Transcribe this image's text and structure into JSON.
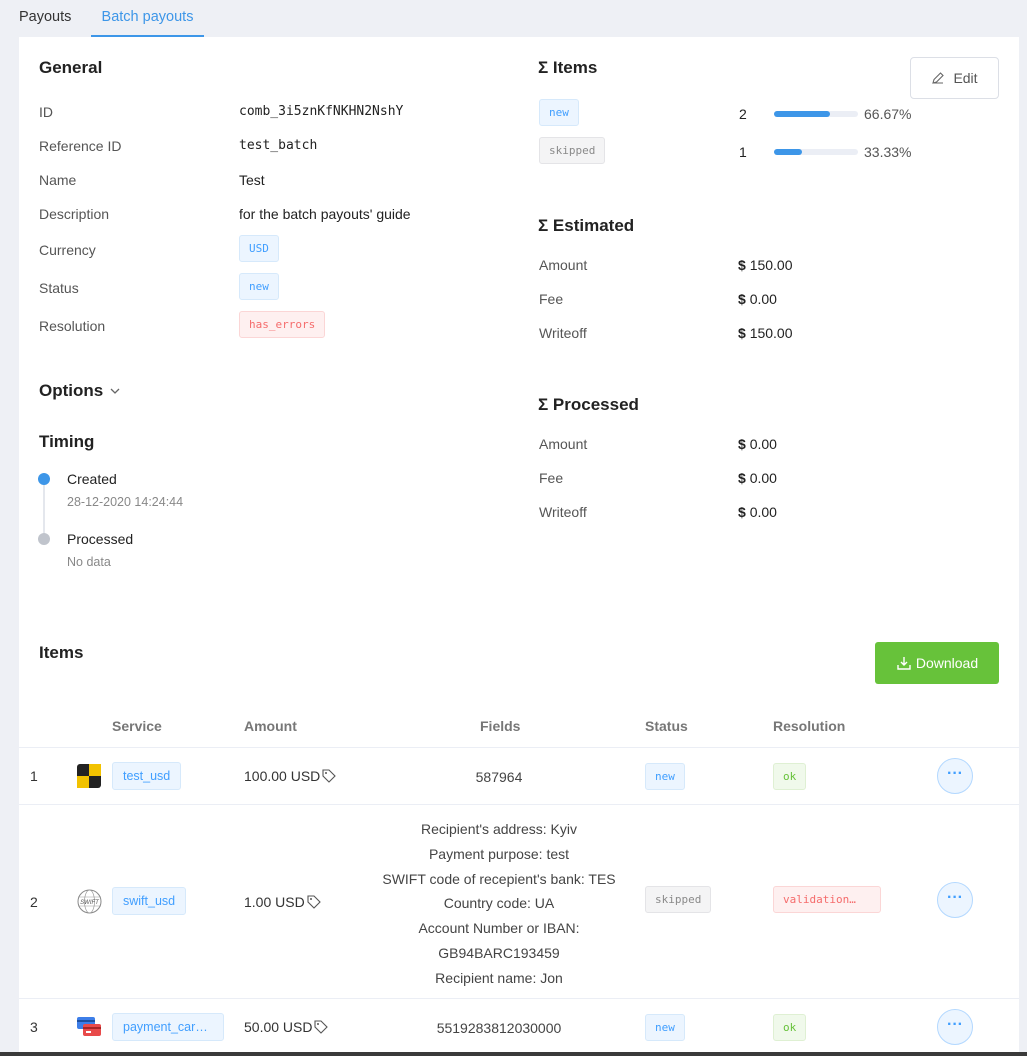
{
  "tabs": [
    {
      "label": "Payouts",
      "active": false
    },
    {
      "label": "Batch payouts",
      "active": true
    }
  ],
  "general": {
    "title": "General",
    "rows": [
      {
        "label": "ID",
        "value": "comb_3i5znKfNKHN2NshY"
      },
      {
        "label": "Reference ID",
        "value": "test_batch"
      },
      {
        "label": "Name",
        "value": "Test"
      },
      {
        "label": "Description",
        "value": "for the batch payouts' guide"
      },
      {
        "label": "Currency",
        "value": "USD"
      },
      {
        "label": "Status",
        "value": "new"
      },
      {
        "label": "Resolution",
        "value": "has_errors"
      }
    ]
  },
  "options": {
    "label": "Options"
  },
  "timing": {
    "title": "Timing",
    "events": [
      {
        "label": "Created",
        "value": "28-12-2020 14:24:44"
      },
      {
        "label": "Processed",
        "value": "No data"
      }
    ]
  },
  "items_summary": {
    "title": "Σ Items",
    "edit_label": "Edit",
    "rows": [
      {
        "status": "new",
        "count": "2",
        "percent_label": "66.67%",
        "fraction": 0.6667
      },
      {
        "status": "skipped",
        "count": "1",
        "percent_label": "33.33%",
        "fraction": 0.3333
      }
    ]
  },
  "estimated": {
    "title": "Σ Estimated",
    "rows": [
      {
        "label": "Amount",
        "currency": "$",
        "value": "150.00"
      },
      {
        "label": "Fee",
        "currency": "$",
        "value": "0.00"
      },
      {
        "label": "Writeoff",
        "currency": "$",
        "value": "150.00"
      }
    ]
  },
  "processed": {
    "title": "Σ Processed",
    "rows": [
      {
        "label": "Amount",
        "currency": "$",
        "value": "0.00"
      },
      {
        "label": "Fee",
        "currency": "$",
        "value": "0.00"
      },
      {
        "label": "Writeoff",
        "currency": "$",
        "value": "0.00"
      }
    ]
  },
  "items": {
    "title": "Items",
    "download_label": "Download",
    "columns": [
      "Service",
      "Amount",
      "Fields",
      "Status",
      "Resolution"
    ],
    "rows": [
      {
        "index": "1",
        "service": "test_usd",
        "service_icon": "checker-flag-icon",
        "amount": "100.00 USD",
        "fields": [
          "587964"
        ],
        "status": "new",
        "resolution": "ok"
      },
      {
        "index": "2",
        "service": "swift_usd",
        "service_icon": "swift-logo-icon",
        "amount": "1.00 USD",
        "fields": [
          "Recipient's address: Kyiv",
          "Payment purpose: test",
          "SWIFT code of recepient's bank: TES",
          "Country code: UA",
          "Account Number or IBAN:",
          "GB94BARC193459",
          "Recipient name: Jon"
        ],
        "status": "skipped",
        "resolution": "validation…"
      },
      {
        "index": "3",
        "service": "payment_card…",
        "service_icon": "payment-cards-icon",
        "amount": "50.00 USD",
        "fields": [
          "5519283812030000"
        ],
        "status": "new",
        "resolution": "ok"
      }
    ]
  },
  "colors": {
    "accent": "#3d96e8",
    "download": "#67c23a",
    "error": "#f56c6c",
    "ok": "#67c23a"
  }
}
